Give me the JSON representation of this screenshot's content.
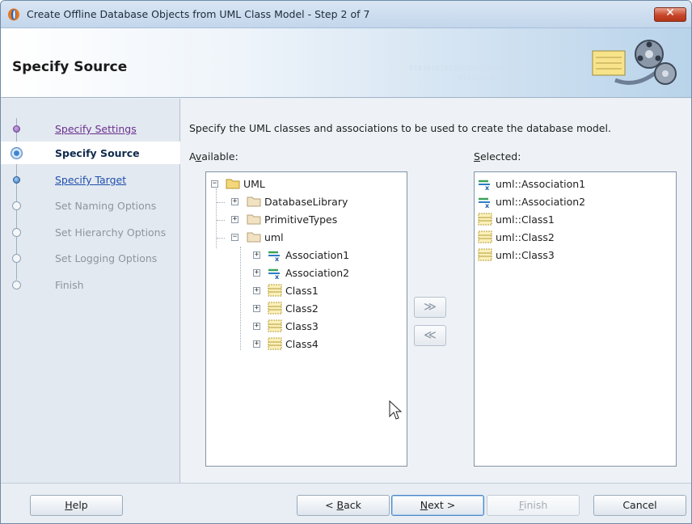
{
  "window": {
    "title": "Create Offline Database Objects from UML Class Model - Step 2 of 7",
    "close_label": "✕"
  },
  "header": {
    "title": "Specify Source",
    "binary_text": "010101010101010101010101010\n                                01010101010"
  },
  "steps": [
    {
      "label": "Specify Settings",
      "state": "done"
    },
    {
      "label": "Specify Source",
      "state": "current"
    },
    {
      "label": "Specify Target",
      "state": "next"
    },
    {
      "label": "Set Naming Options",
      "state": "disabled"
    },
    {
      "label": "Set Hierarchy Options",
      "state": "disabled"
    },
    {
      "label": "Set Logging Options",
      "state": "disabled"
    },
    {
      "label": "Finish",
      "state": "disabled"
    }
  ],
  "content": {
    "instruction": "Specify the UML classes and associations to be used to create the database model.",
    "available_label_pre": "A",
    "available_label_mn": "v",
    "available_label_post": "ailable:",
    "selected_label_mn": "S",
    "selected_label_post": "elected:"
  },
  "available_tree": [
    {
      "label": "UML",
      "icon": "folder-icon",
      "expander": "−"
    },
    {
      "label": "DatabaseLibrary",
      "icon": "package-icon",
      "expander": "+"
    },
    {
      "label": "PrimitiveTypes",
      "icon": "package-icon",
      "expander": "+"
    },
    {
      "label": "uml",
      "icon": "package-icon",
      "expander": "−"
    },
    {
      "label": "Association1",
      "icon": "association-icon",
      "expander": "+"
    },
    {
      "label": "Association2",
      "icon": "association-icon",
      "expander": "+"
    },
    {
      "label": "Class1",
      "icon": "class-icon",
      "expander": "+"
    },
    {
      "label": "Class2",
      "icon": "class-icon",
      "expander": "+"
    },
    {
      "label": "Class3",
      "icon": "class-icon",
      "expander": "+"
    },
    {
      "label": "Class4",
      "icon": "class-icon",
      "expander": "+"
    }
  ],
  "selected_list": [
    {
      "label": "uml::Association1",
      "icon": "association-icon"
    },
    {
      "label": "uml::Association2",
      "icon": "association-icon"
    },
    {
      "label": "uml::Class1",
      "icon": "class-icon"
    },
    {
      "label": "uml::Class2",
      "icon": "class-icon"
    },
    {
      "label": "uml::Class3",
      "icon": "class-icon"
    }
  ],
  "move_buttons": {
    "add": "≫",
    "remove": "≪"
  },
  "footer": {
    "help_mn": "H",
    "help_post": "elp",
    "back_pre": "< ",
    "back_mn": "B",
    "back_post": "ack",
    "next_mn": "N",
    "next_post": "ext >",
    "finish_mn": "F",
    "finish_post": "inish",
    "cancel": "Cancel"
  },
  "colors": {
    "accent": "#3576bf",
    "visited_link": "#6a2f8f",
    "link": "#1f4fae",
    "disabled_text": "#8d959e"
  }
}
